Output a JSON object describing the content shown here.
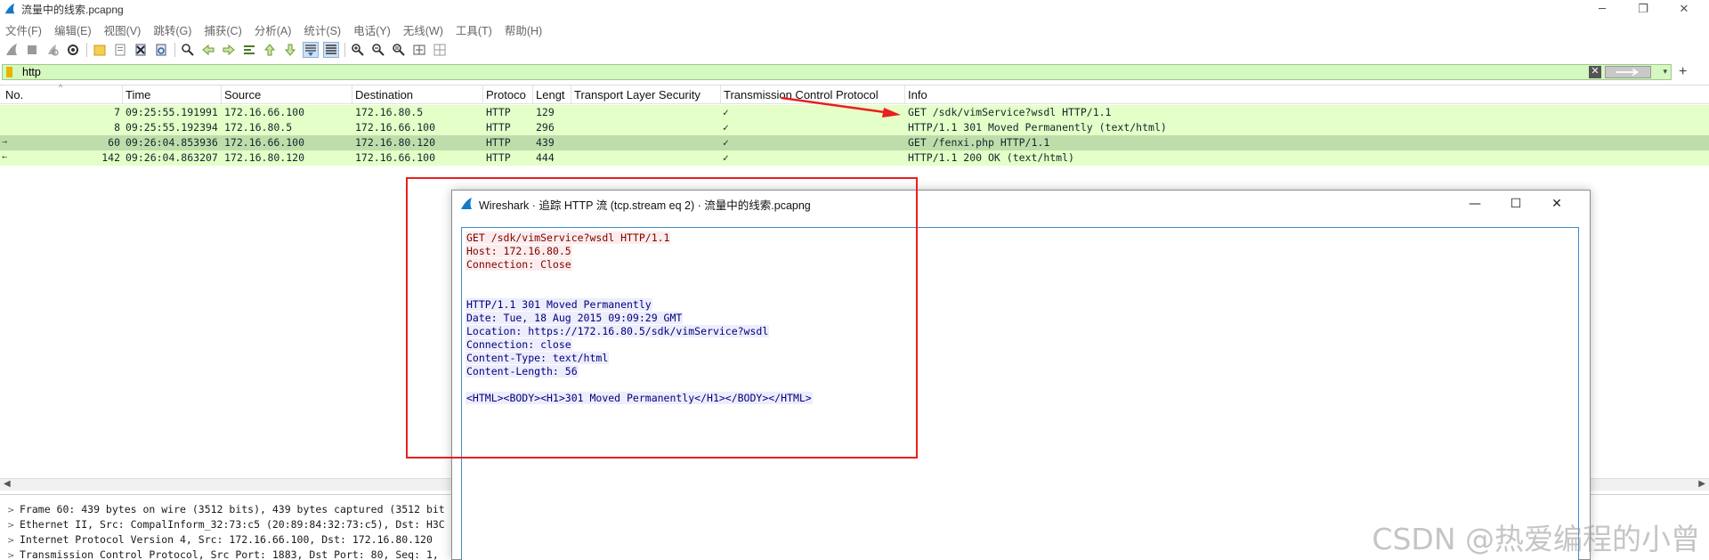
{
  "window": {
    "title": "流量中的线索.pcapng",
    "controls": {
      "minimize": "─",
      "restore": "❐",
      "close": "✕"
    }
  },
  "menu": [
    "文件(F)",
    "编辑(E)",
    "视图(V)",
    "跳转(G)",
    "捕获(C)",
    "分析(A)",
    "统计(S)",
    "电话(Y)",
    "无线(W)",
    "工具(T)",
    "帮助(H)"
  ],
  "filter": {
    "value": "http",
    "clear_icon": "✕",
    "apply_icon": "arrow-right-icon",
    "dropdown_icon": "▾",
    "add_button": "+"
  },
  "packet_list": {
    "columns": [
      "No.",
      "Time",
      "Source",
      "Destination",
      "Protocol",
      "Length",
      "Transport Layer Security",
      "Transmission Control Protocol",
      "Info"
    ],
    "column_labels_shown": [
      "No.",
      "Time",
      "Source",
      "Destination",
      "Protoco",
      "Lengt",
      "Transport Layer Security",
      "Transmission Control Protocol",
      "Info"
    ],
    "rows": [
      {
        "no": "7",
        "time": "09:25:55.191991",
        "source": "172.16.66.100",
        "destination": "172.16.80.5",
        "protocol": "HTTP",
        "length": "129",
        "tls": "",
        "tcp": "✓",
        "info": "GET /sdk/vimService?wsdl HTTP/1.1",
        "selected": false,
        "marker": ""
      },
      {
        "no": "8",
        "time": "09:25:55.192394",
        "source": "172.16.80.5",
        "destination": "172.16.66.100",
        "protocol": "HTTP",
        "length": "296",
        "tls": "",
        "tcp": "✓",
        "info": "HTTP/1.1 301 Moved Permanently  (text/html)",
        "selected": false,
        "marker": ""
      },
      {
        "no": "60",
        "time": "09:26:04.853936",
        "source": "172.16.66.100",
        "destination": "172.16.80.120",
        "protocol": "HTTP",
        "length": "439",
        "tls": "",
        "tcp": "✓",
        "info": "GET /fenxi.php HTTP/1.1",
        "selected": true,
        "marker": "→"
      },
      {
        "no": "142",
        "time": "09:26:04.863207",
        "source": "172.16.80.120",
        "destination": "172.16.66.100",
        "protocol": "HTTP",
        "length": "444",
        "tls": "",
        "tcp": "✓",
        "info": "HTTP/1.1 200 OK  (text/html)",
        "selected": false,
        "marker": "←"
      }
    ]
  },
  "details": [
    "Frame 60: 439 bytes on wire (3512 bits), 439 bytes captured (3512 bit",
    "Ethernet II, Src: CompalInform_32:73:c5 (20:89:84:32:73:c5), Dst: H3C",
    "Internet Protocol Version 4, Src: 172.16.66.100, Dst: 172.16.80.120",
    "Transmission Control Protocol, Src Port: 1883, Dst Port: 80, Seq: 1,"
  ],
  "dialog": {
    "title": "Wireshark · 追踪 HTTP 流 (tcp.stream eq 2) · 流量中的线索.pcapng",
    "controls": {
      "minimize": "—",
      "maximize": "☐",
      "close": "✕"
    },
    "stream": [
      {
        "text": "GET /sdk/vimService?wsdl HTTP/1.1",
        "side": "client"
      },
      {
        "text": "Host: 172.16.80.5",
        "side": "client"
      },
      {
        "text": "Connection: Close",
        "side": "client"
      },
      {
        "text": "HTTP/1.1 301 Moved Permanently",
        "side": "server"
      },
      {
        "text": "Date: Tue, 18 Aug 2015 09:09:29 GMT",
        "side": "server"
      },
      {
        "text": "Location: https://172.16.80.5/sdk/vimService?wsdl",
        "side": "server"
      },
      {
        "text": "Connection: close",
        "side": "server"
      },
      {
        "text": "Content-Type: text/html",
        "side": "server"
      },
      {
        "text": "Content-Length: 56",
        "side": "server"
      },
      {
        "text": "<HTML><BODY><H1>301 Moved Permanently</H1></BODY></HTML>",
        "side": "server"
      }
    ],
    "colors": {
      "client_text": "#7f0000",
      "client_bg": "#fbeded",
      "server_text": "#00007f",
      "server_bg": "#ededfb"
    }
  },
  "colors": {
    "row_bg": "#e4ffc7",
    "row_selected_bg": "#bfddaa",
    "filter_bg": "#d5f7c0",
    "annotation_red": "#ea1f1f"
  },
  "watermark": "CSDN @热爱编程的小曾"
}
